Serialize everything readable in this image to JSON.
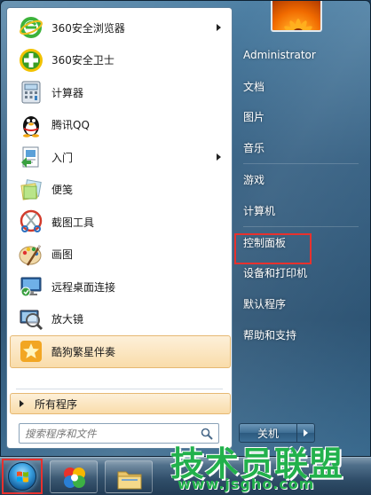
{
  "start_menu": {
    "programs": [
      {
        "label": "360安全浏览器",
        "icon": "browser-360-icon",
        "has_arrow": true
      },
      {
        "label": "360安全卫士",
        "icon": "security-360-icon",
        "has_arrow": false
      },
      {
        "label": "计算器",
        "icon": "calculator-icon",
        "has_arrow": false
      },
      {
        "label": "腾讯QQ",
        "icon": "qq-penguin-icon",
        "has_arrow": false
      },
      {
        "label": "入门",
        "icon": "getting-started-icon",
        "has_arrow": true
      },
      {
        "label": "便笺",
        "icon": "sticky-notes-icon",
        "has_arrow": false
      },
      {
        "label": "截图工具",
        "icon": "snipping-tool-icon",
        "has_arrow": false
      },
      {
        "label": "画图",
        "icon": "paint-icon",
        "has_arrow": false
      },
      {
        "label": "远程桌面连接",
        "icon": "remote-desktop-icon",
        "has_arrow": false
      },
      {
        "label": "放大镜",
        "icon": "magnifier-icon",
        "has_arrow": false
      },
      {
        "label": "酷狗繁星伴奏",
        "icon": "kugou-icon",
        "has_arrow": false,
        "highlighted": true
      }
    ],
    "all_programs_label": "所有程序",
    "search": {
      "placeholder": "搜索程序和文件"
    },
    "right_links": {
      "user": "Administrator",
      "documents": "文档",
      "pictures": "图片",
      "music": "音乐",
      "games": "游戏",
      "computer": "计算机",
      "control_panel": "控制面板",
      "devices_printers": "设备和打印机",
      "default_programs": "默认程序",
      "help_support": "帮助和支持"
    },
    "shutdown_label": "关机"
  },
  "watermark": {
    "title": "技术员联盟",
    "url": "www.jsgho.com"
  },
  "colors": {
    "highlight_red": "#e8312d",
    "selection_orange": "#f9dcaa",
    "watermark_green": "#22b14c",
    "menu_blue": "#2e5a7e"
  }
}
